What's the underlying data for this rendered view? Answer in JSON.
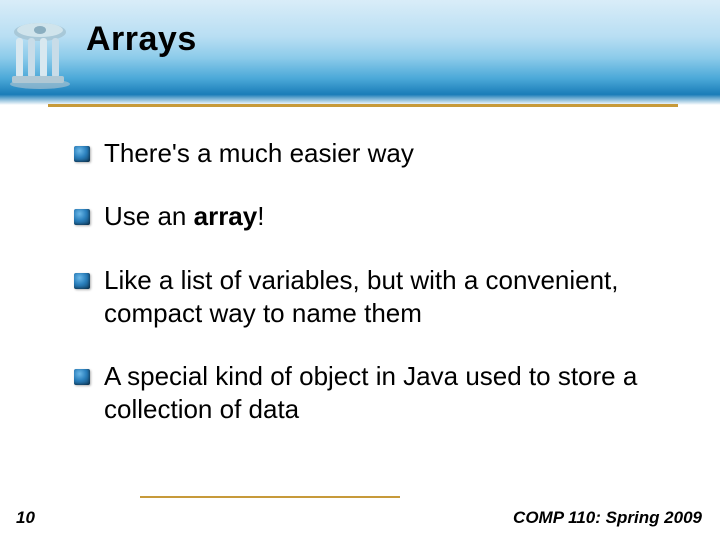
{
  "header": {
    "title": "Arrays"
  },
  "bullets": [
    {
      "pre": "There's a much easier way",
      "bold": "",
      "post": ""
    },
    {
      "pre": "Use an ",
      "bold": "array",
      "post": "!"
    },
    {
      "pre": "Like a list of variables, but with a convenient, compact way to name them",
      "bold": "",
      "post": ""
    },
    {
      "pre": "A special kind of object in Java used to store a collection of data",
      "bold": "",
      "post": ""
    }
  ],
  "footer": {
    "page": "10",
    "course": "COMP 110: Spring 2009"
  }
}
